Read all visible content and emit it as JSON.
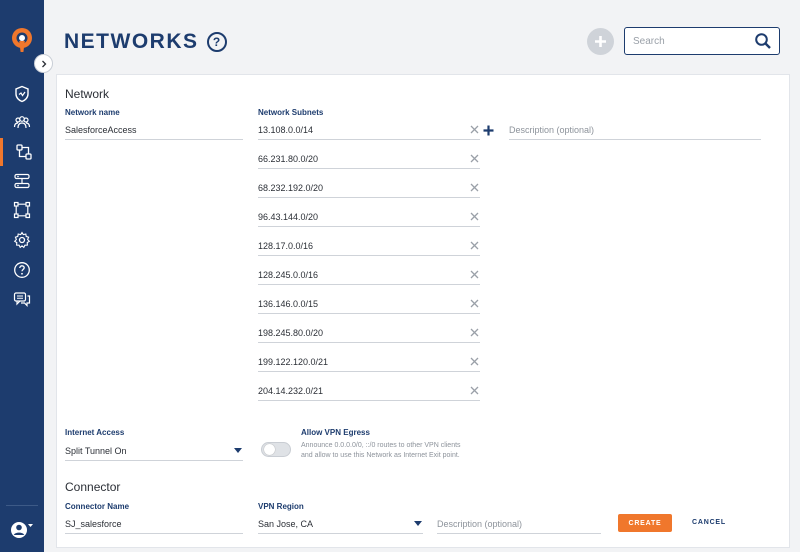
{
  "header": {
    "title": "NETWORKS",
    "help_icon_text": "?",
    "search_placeholder": "Search"
  },
  "sidebar": {
    "items": [
      {
        "icon": "shield-icon",
        "active": false
      },
      {
        "icon": "users-icon",
        "active": false
      },
      {
        "icon": "networks-icon",
        "active": true
      },
      {
        "icon": "servers-icon",
        "active": false
      },
      {
        "icon": "topology-icon",
        "active": false
      },
      {
        "icon": "gear-icon",
        "active": false
      },
      {
        "icon": "help-icon",
        "active": false
      },
      {
        "icon": "chat-icon",
        "active": false
      }
    ]
  },
  "network": {
    "section_title": "Network",
    "name_label": "Network name",
    "name_value": "SalesforceAccess",
    "subnets_label": "Network Subnets",
    "subnets": [
      "13.108.0.0/14",
      "66.231.80.0/20",
      "68.232.192.0/20",
      "96.43.144.0/20",
      "128.17.0.0/16",
      "128.245.0.0/16",
      "136.146.0.0/15",
      "198.245.80.0/20",
      "199.122.120.0/21",
      "204.14.232.0/21"
    ],
    "description_placeholder": "Description (optional)",
    "internet_access_label": "Internet Access",
    "internet_access_value": "Split Tunnel On",
    "egress_label": "Allow VPN Egress",
    "egress_desc_line1": "Announce 0.0.0.0/0, ::/0 routes to other VPN clients",
    "egress_desc_line2": "and allow to use this Network as Internet Exit point."
  },
  "connector": {
    "section_title": "Connector",
    "name_label": "Connector Name",
    "name_value": "SJ_salesforce",
    "region_label": "VPN Region",
    "region_value": "San Jose, CA",
    "description_placeholder": "Description (optional)",
    "create_label": "CREATE",
    "cancel_label": "CANCEL"
  },
  "colors": {
    "sidebar": "#1d3c6e",
    "accent": "#f0772c",
    "title": "#1d3c6e"
  }
}
